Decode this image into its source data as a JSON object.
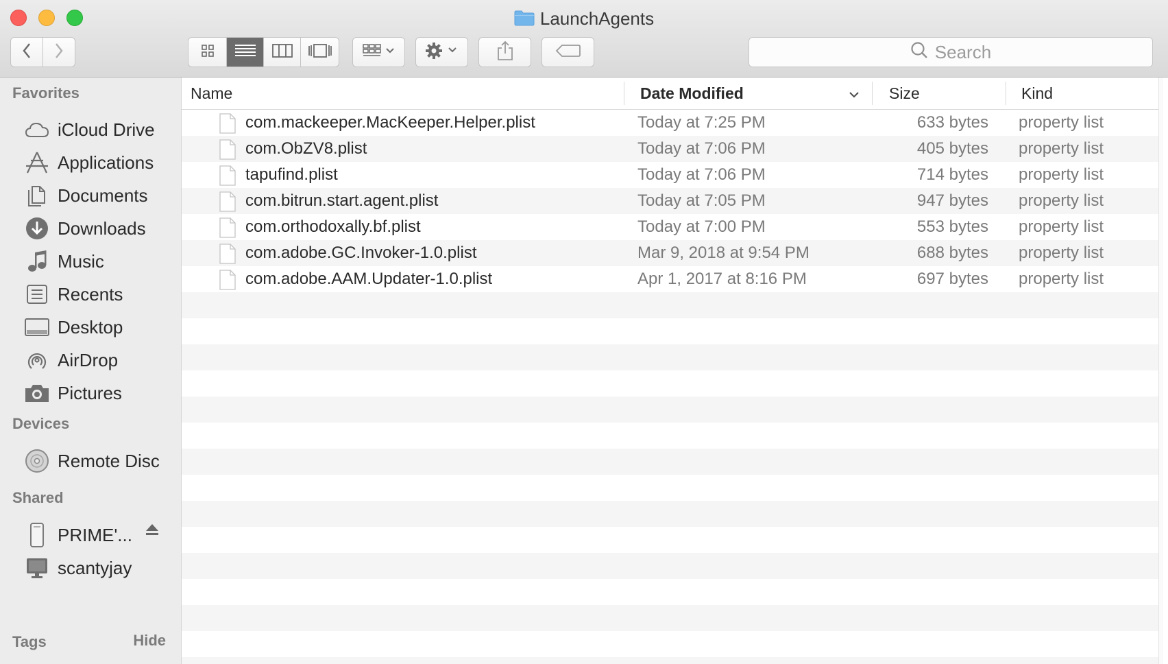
{
  "window": {
    "title": "LaunchAgents"
  },
  "toolbar": {
    "back": "chevron-left-icon",
    "forward": "chevron-right-icon",
    "view_modes": [
      "icon-view",
      "list-view",
      "column-view",
      "cover-flow-view"
    ],
    "active_view": "list-view",
    "search_placeholder": "Search"
  },
  "sidebar": {
    "favorites_label": "Favorites",
    "favorites": [
      {
        "label": "iCloud Drive",
        "icon": "cloud-icon"
      },
      {
        "label": "Applications",
        "icon": "applications-icon"
      },
      {
        "label": "Documents",
        "icon": "documents-icon"
      },
      {
        "label": "Downloads",
        "icon": "download-icon"
      },
      {
        "label": "Music",
        "icon": "music-icon"
      },
      {
        "label": "Recents",
        "icon": "recents-icon"
      },
      {
        "label": "Desktop",
        "icon": "desktop-icon"
      },
      {
        "label": "AirDrop",
        "icon": "airdrop-icon"
      },
      {
        "label": "Pictures",
        "icon": "camera-icon"
      }
    ],
    "devices_label": "Devices",
    "devices": [
      {
        "label": "Remote Disc",
        "icon": "disc-icon"
      }
    ],
    "shared_label": "Shared",
    "shared": [
      {
        "label": "PRIME'...",
        "icon": "server-icon"
      },
      {
        "label": "scantyjay",
        "icon": "computer-icon"
      }
    ],
    "tags_label": "Tags",
    "hide_label": "Hide"
  },
  "columns": {
    "name": "Name",
    "date": "Date Modified",
    "size": "Size",
    "kind": "Kind"
  },
  "files": [
    {
      "name": "com.mackeeper.MacKeeper.Helper.plist",
      "date": "Today at 7:25 PM",
      "size": "633 bytes",
      "kind": "property list"
    },
    {
      "name": "com.ObZV8.plist",
      "date": "Today at 7:06 PM",
      "size": "405 bytes",
      "kind": "property list"
    },
    {
      "name": "tapufind.plist",
      "date": "Today at 7:06 PM",
      "size": "714 bytes",
      "kind": "property list"
    },
    {
      "name": "com.bitrun.start.agent.plist",
      "date": "Today at 7:05 PM",
      "size": "947 bytes",
      "kind": "property list"
    },
    {
      "name": "com.orthodoxally.bf.plist",
      "date": "Today at 7:00 PM",
      "size": "553 bytes",
      "kind": "property list"
    },
    {
      "name": "com.adobe.GC.Invoker-1.0.plist",
      "date": "Mar 9, 2018 at 9:54 PM",
      "size": "688 bytes",
      "kind": "property list"
    },
    {
      "name": "com.adobe.AAM.Updater-1.0.plist",
      "date": "Apr 1, 2017 at 8:16 PM",
      "size": "697 bytes",
      "kind": "property list"
    }
  ]
}
